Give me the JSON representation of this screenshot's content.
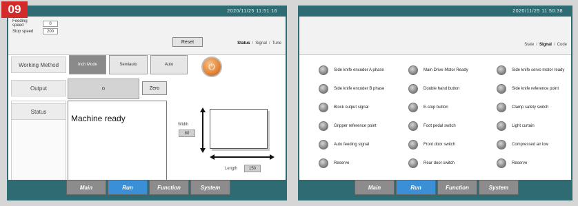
{
  "badge": "09",
  "left": {
    "datetime": "2020/11/25   11:51:16",
    "speed1_label": "Feeding speed",
    "speed1_value": "0",
    "speed2_label": "Stop speed",
    "speed2_value": "200",
    "reset_label": "Reset",
    "subtabs": [
      "Status",
      "Signal",
      "Tune"
    ],
    "working_method_label": "Working Method",
    "modes": [
      "Inch Mode",
      "Semiauto",
      "Auto"
    ],
    "output_label": "Output",
    "output_value": "0",
    "zero_label": "Zero",
    "status_label": "Status",
    "status_text": "Machine ready",
    "width_label": "Width",
    "width_value": "80",
    "length_label": "Length",
    "length_value": "150"
  },
  "right": {
    "datetime": "2020/11/25   11:50:38",
    "subtabs": [
      "State",
      "Signal",
      "Code"
    ],
    "signals_col1": [
      "Side knife encoder A phase",
      "Side knife encoder B phase",
      "Block output signal",
      "Gripper reference point",
      "Auto feeding signal",
      "Reserve"
    ],
    "signals_col2": [
      "Main Drive Motor Ready",
      "Double hand button",
      "E-stop button",
      "Foot pedal switch",
      "Front door switch",
      "Rear door switch"
    ],
    "signals_col3": [
      "Side knife servo motor ready",
      "Side knife reference point",
      "Clamp safety switch",
      "Light curtain",
      "Compressed air low",
      "Reserve"
    ]
  },
  "nav": [
    "Main",
    "Run",
    "Function",
    "System"
  ],
  "colors": {
    "bar": "#2f6b72",
    "active_tab": "#3a8fd6",
    "badge": "#d32a2a"
  }
}
